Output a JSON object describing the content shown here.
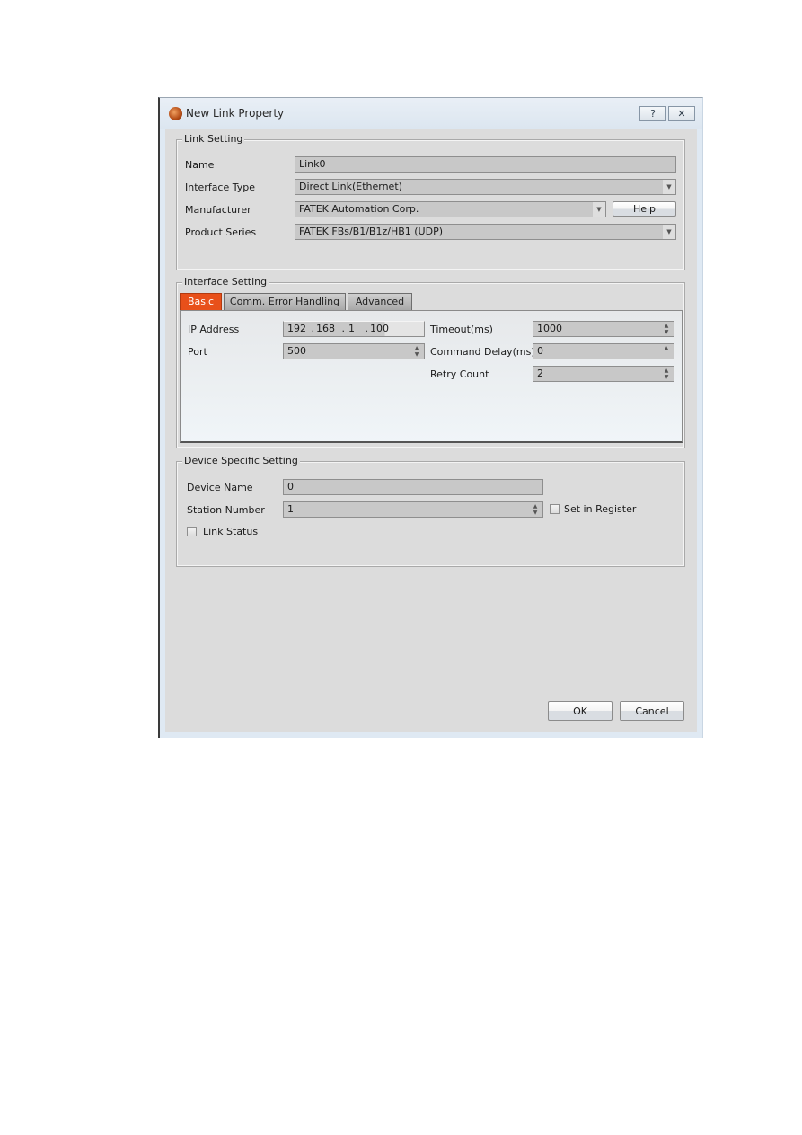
{
  "dialog": {
    "title": "New Link Property",
    "help_button_glyph": "?",
    "close_button_glyph": "✕",
    "icon": "app-logo-icon"
  },
  "link_setting": {
    "group_label": "Link Setting",
    "name_label": "Name",
    "name_value": "Link0",
    "interface_type_label": "Interface Type",
    "interface_type_value": "Direct Link(Ethernet)",
    "manufacturer_label": "Manufacturer",
    "manufacturer_value": "FATEK Automation Corp.",
    "help_button": "Help",
    "product_series_label": "Product Series",
    "product_series_value": "FATEK FBs/B1/B1z/HB1 (UDP)",
    "dropdown_glyph": "▼"
  },
  "interface_setting": {
    "group_label": "Interface Setting",
    "tabs": [
      {
        "label": "Basic",
        "active": true
      },
      {
        "label": "Comm. Error Handling",
        "active": false
      },
      {
        "label": "Advanced",
        "active": false
      }
    ],
    "ip_address_label": "IP Address",
    "ip_octets": [
      "192",
      "168",
      "1",
      "100"
    ],
    "port_label": "Port",
    "port_value": "500",
    "timeout_label": "Timeout(ms)",
    "timeout_value": "1000",
    "command_delay_label": "Command Delay(ms)",
    "command_delay_value": "0",
    "retry_count_label": "Retry Count",
    "retry_count_value": "2",
    "spin_up": "▲",
    "spin_down": "▼"
  },
  "device_specific_setting": {
    "group_label": "Device Specific Setting",
    "device_name_label": "Device Name",
    "device_name_value": "0",
    "station_number_label": "Station Number",
    "station_number_value": "1",
    "set_in_register_label": "Set in Register",
    "set_in_register_checked": false,
    "link_status_label": "Link Status",
    "link_status_checked": false
  },
  "footer": {
    "ok_button": "OK",
    "cancel_button": "Cancel"
  }
}
